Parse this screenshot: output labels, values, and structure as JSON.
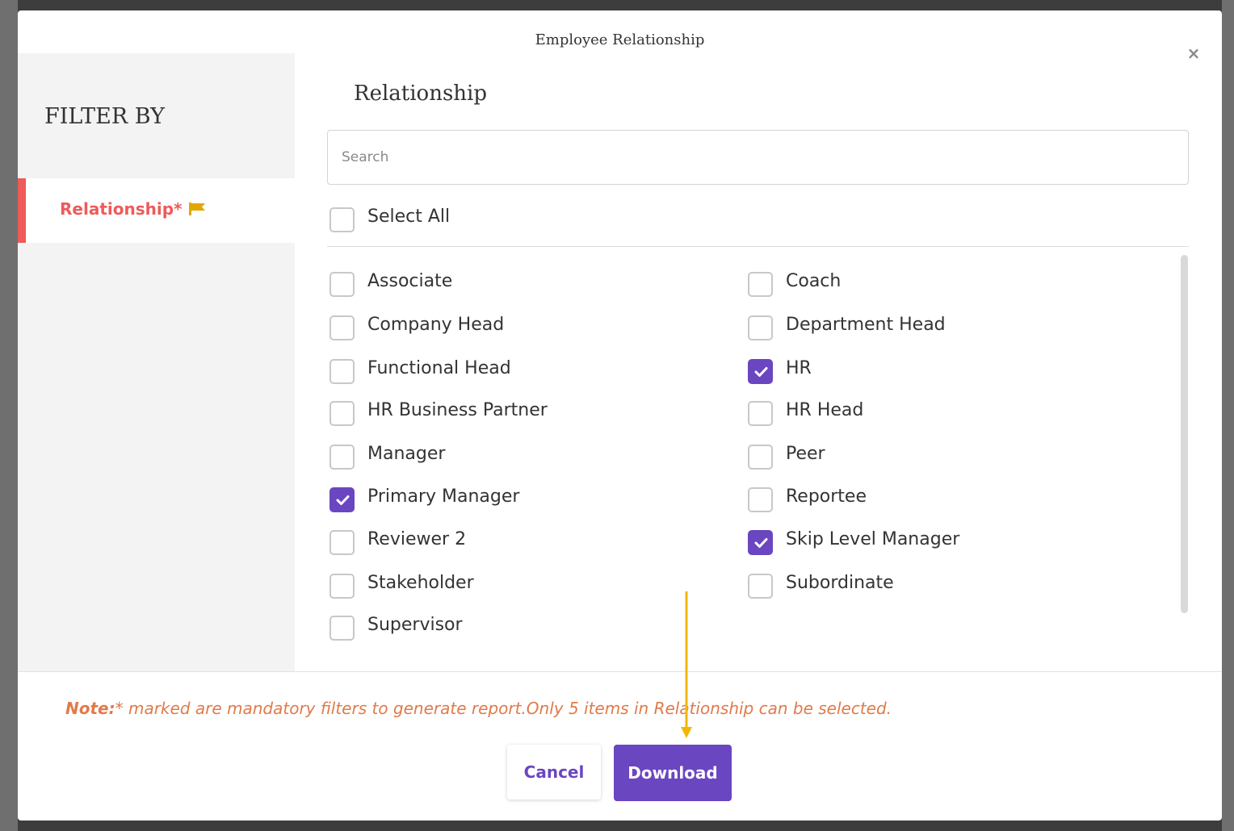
{
  "modal": {
    "title": "Employee Relationship",
    "close_icon": "close-icon"
  },
  "sidebar": {
    "heading": "FILTER BY",
    "items": [
      {
        "label": "Relationship*",
        "icon": "flag-icon",
        "active": true
      }
    ]
  },
  "main": {
    "section_title": "Relationship",
    "search": {
      "placeholder": "Search",
      "value": ""
    },
    "select_all": {
      "label": "Select All",
      "checked": false
    },
    "options": [
      {
        "label": "Associate",
        "checked": false
      },
      {
        "label": "Coach",
        "checked": false
      },
      {
        "label": "Company Head",
        "checked": false
      },
      {
        "label": "Department Head",
        "checked": false
      },
      {
        "label": "Functional Head",
        "checked": false
      },
      {
        "label": "HR",
        "checked": true
      },
      {
        "label": "HR Business Partner",
        "checked": false
      },
      {
        "label": "HR Head",
        "checked": false
      },
      {
        "label": "Manager",
        "checked": false
      },
      {
        "label": "Peer",
        "checked": false
      },
      {
        "label": "Primary Manager",
        "checked": true
      },
      {
        "label": "Reportee",
        "checked": false
      },
      {
        "label": "Reviewer 2",
        "checked": false
      },
      {
        "label": "Skip Level Manager",
        "checked": true
      },
      {
        "label": "Stakeholder",
        "checked": false
      },
      {
        "label": "Subordinate",
        "checked": false
      },
      {
        "label": "Supervisor",
        "checked": false
      }
    ]
  },
  "footer": {
    "note_prefix": "Note:",
    "note_text": "* marked are mandatory filters to generate report.Only 5 items in Relationship can be selected.",
    "cancel_label": "Cancel",
    "download_label": "Download"
  },
  "colors": {
    "accent": "#6b46c1",
    "sidebar_active": "#ef5a5a",
    "note": "#e07a4a",
    "flag": "#e0a800",
    "annotation_arrow": "#f2b705"
  }
}
